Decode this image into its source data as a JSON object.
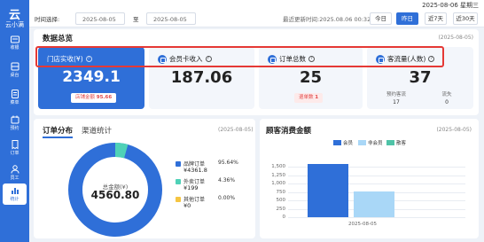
{
  "system": {
    "datetime": "2025-08-06 星期三"
  },
  "sidebar": {
    "logo_mark": "云",
    "logo_name": "云小满",
    "items": [
      {
        "label": "收银",
        "icon": "cashier-icon"
      },
      {
        "label": "桌台",
        "icon": "table-icon"
      },
      {
        "label": "菜单",
        "icon": "menu-icon"
      },
      {
        "label": "预约",
        "icon": "reservation-icon"
      },
      {
        "label": "订单",
        "icon": "order-icon"
      },
      {
        "label": "员工",
        "icon": "staff-icon"
      },
      {
        "label": "统计",
        "icon": "stats-icon",
        "active": true
      }
    ]
  },
  "filter": {
    "label": "时间选择:",
    "start_date": "2025-08-05",
    "to_label": "至",
    "end_date": "2025-08-05",
    "updated": "最近更新时间:2025.08.06 00:32",
    "buttons": [
      {
        "label": "今日",
        "active": false
      },
      {
        "label": "昨日",
        "active": true
      },
      {
        "label": "近7天",
        "active": false
      },
      {
        "label": "近30天",
        "active": false
      }
    ]
  },
  "overview": {
    "title": "数据总览",
    "date": "(2025-08-05)",
    "cards": [
      {
        "title": "门店实收(¥)",
        "value": "2349.1",
        "badge_label": "店铺金额",
        "badge_value": "95.66"
      },
      {
        "title": "会员卡收入",
        "value": "187.06"
      },
      {
        "title": "订单总数",
        "value": "25",
        "badge_label": "退单数",
        "badge_value": "1"
      },
      {
        "title": "客流量(人数)",
        "value": "37",
        "sub_labels": [
          "预约客流",
          "流失"
        ],
        "sub_values": [
          "17",
          "0"
        ]
      }
    ]
  },
  "order_dist": {
    "tab_active": "订单分布",
    "tab_other": "渠道统计",
    "date": "(2025-08-05)",
    "center_label": "总金额(¥)",
    "center_value": "4560.80",
    "legend": [
      {
        "name": "品牌订单",
        "pct": "95.64%",
        "value": "¥4361.8",
        "color": "#2f6fd8"
      },
      {
        "name": "外卖订单",
        "pct": "4.36%",
        "value": "¥199",
        "color": "#4fd1b7"
      },
      {
        "name": "其他订单",
        "pct": "0.00%",
        "value": "¥0",
        "color": "#f5c542"
      }
    ]
  },
  "chart_data": {
    "type": "bar",
    "title": "顾客消费金额",
    "date": "(2025-08-05)",
    "categories": [
      "2025-08-05"
    ],
    "series": [
      {
        "name": "会员",
        "values": [
          1600
        ],
        "color": "#2f6fd8"
      },
      {
        "name": "非会员",
        "values": [
          780
        ],
        "color": "#a9d7f7"
      },
      {
        "name": "散客",
        "values": [
          0
        ],
        "color": "#4fc3a7"
      }
    ],
    "yticks": [
      "1,500",
      "1,250",
      "1,000",
      "750",
      "500",
      "250",
      "0"
    ],
    "ylim": [
      0,
      1750
    ]
  }
}
